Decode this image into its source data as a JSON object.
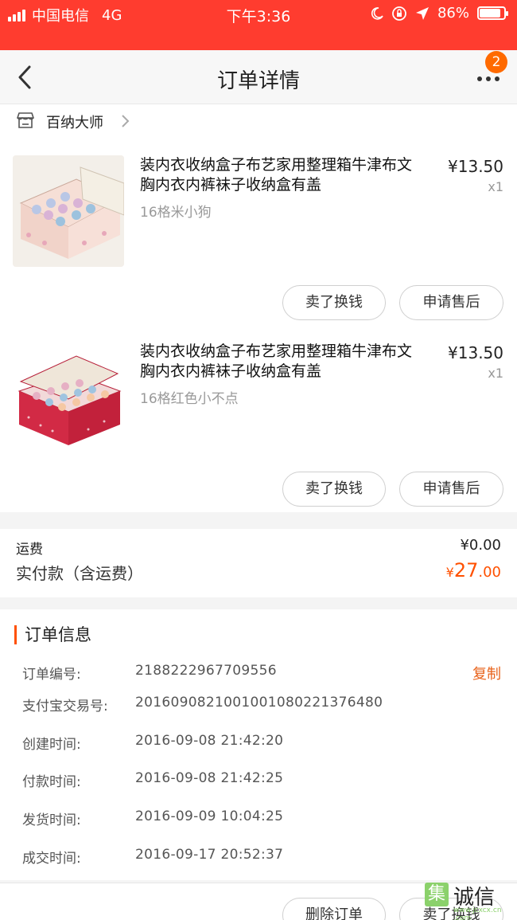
{
  "status_bar": {
    "carrier": "中国电信",
    "network": "4G",
    "time": "下午3:36",
    "battery_percent": "86%",
    "battery_level": 0.86
  },
  "nav": {
    "title": "订单详情",
    "badge_count": "2",
    "back_icon": "chevron-left-icon",
    "more_icon": "more-dots-icon"
  },
  "shop": {
    "name": "百纳大师",
    "icon": "store-icon"
  },
  "items": [
    {
      "title": "装内衣收纳盒子布艺家用整理箱牛津布文胸内衣内裤袜子收纳盒有盖",
      "spec": "16格米小狗",
      "price": "¥13.50",
      "qty": "x1",
      "button_sell": "卖了换钱",
      "button_aftersale": "申请售后"
    },
    {
      "title": "装内衣收纳盒子布艺家用整理箱牛津布文胸内衣内裤袜子收纳盒有盖",
      "spec": "16格红色小不点",
      "price": "¥13.50",
      "qty": "x1",
      "button_sell": "卖了换钱",
      "button_aftersale": "申请售后"
    }
  ],
  "fees": {
    "shipping_label": "运费",
    "shipping_value": "¥0.00",
    "paid_label": "实付款（含运费）",
    "paid_currency": "¥",
    "paid_int": "27",
    "paid_dec": ".00"
  },
  "order_info": {
    "heading": "订单信息",
    "copy_label": "复制",
    "rows": [
      {
        "key": "订单编号:",
        "value": "2188222967709556"
      },
      {
        "key": "支付宝交易号:",
        "value": "2016090821001001080221376480"
      },
      {
        "key": "创建时间:",
        "value": "2016-09-08 21:42:20"
      },
      {
        "key": "付款时间:",
        "value": "2016-09-08 21:42:25"
      },
      {
        "key": "发货时间:",
        "value": "2016-09-09 10:04:25"
      },
      {
        "key": "成交时间:",
        "value": "2016-09-17 20:52:37"
      }
    ]
  },
  "bottom_actions": {
    "delete_label": "删除订单",
    "sell_label": "卖了换钱"
  },
  "watermark": {
    "box_char": "集",
    "text": "诚信",
    "sub": "www.jcxcx.cn .com"
  },
  "colors": {
    "status_bar": "#ff3c2f",
    "accent": "#ff5000",
    "copy": "#e8621a",
    "badge": "#ff6a00"
  }
}
